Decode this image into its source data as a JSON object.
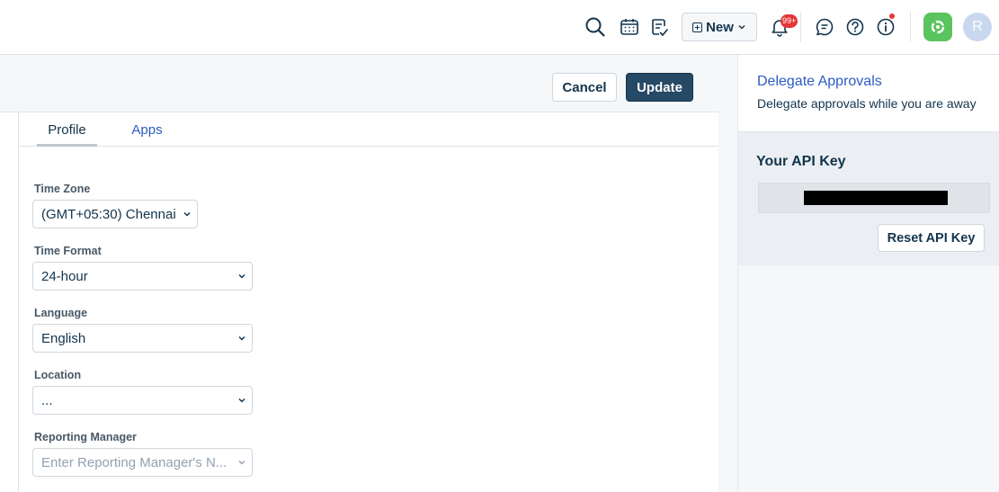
{
  "topbar": {
    "icons": [
      "search-icon",
      "calendar-icon",
      "notes-icon",
      "bell-icon",
      "chat-icon",
      "help-icon",
      "info-icon"
    ],
    "new_label": "New",
    "notification_count": "99+",
    "avatar_initial": "R",
    "colors": {
      "badge": "#e43538",
      "app_logo": "#5ac45f",
      "avatar": "#c9d8ef"
    }
  },
  "actions": {
    "cancel_label": "Cancel",
    "update_label": "Update"
  },
  "tabs": [
    {
      "label": "Profile",
      "active": true
    },
    {
      "label": "Apps",
      "active": false
    }
  ],
  "form": {
    "time_zone": {
      "label": "Time Zone",
      "value": "(GMT+05:30) Chennai"
    },
    "time_format": {
      "label": "Time Format",
      "value": "24-hour"
    },
    "language": {
      "label": "Language",
      "value": "English"
    },
    "location": {
      "label": "Location",
      "value": "..."
    },
    "reporting_manager": {
      "label": "Reporting Manager",
      "placeholder": "Enter Reporting Manager's N..."
    }
  },
  "right_panel": {
    "delegate_title": "Delegate Approvals",
    "delegate_desc": "Delegate approvals while you are away",
    "api_key_title": "Your API Key",
    "reset_label": "Reset API Key"
  },
  "theme": {
    "primary": "#264966",
    "link": "#2c5cc5",
    "text": "#12344d"
  }
}
